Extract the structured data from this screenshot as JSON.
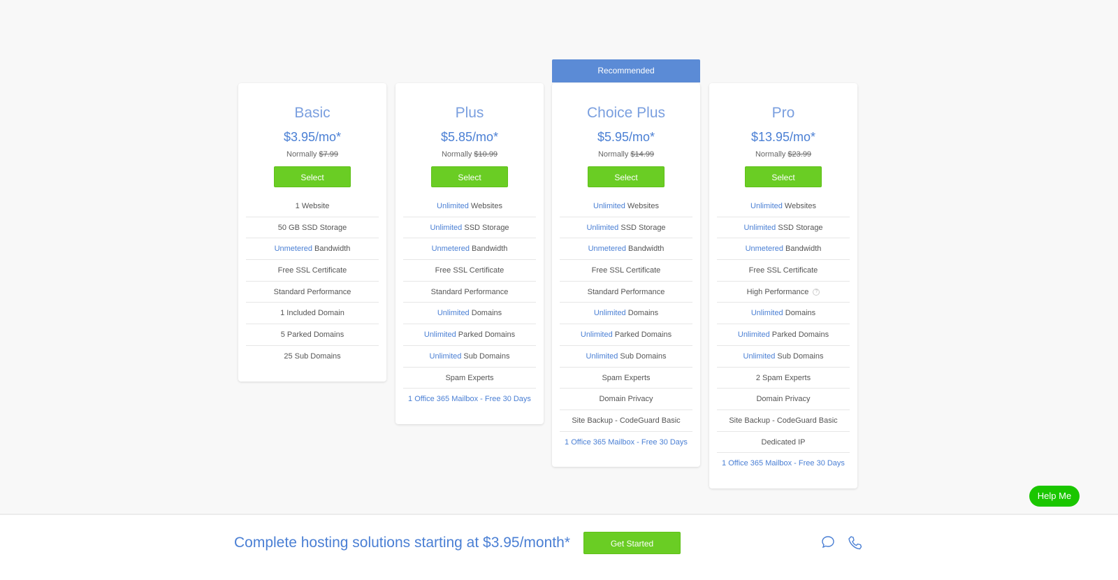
{
  "recommended_label": "Recommended",
  "plans": [
    {
      "name": "Basic",
      "price": "$3.95/mo*",
      "normally_label": "Normally",
      "normal_price": "$7.99",
      "select_label": "Select",
      "features": [
        {
          "hl": "",
          "text": "1 Website"
        },
        {
          "hl": "",
          "text": "50 GB SSD Storage"
        },
        {
          "hl": "Unmetered",
          "text": " Bandwidth"
        },
        {
          "hl": "",
          "text": "Free SSL Certificate"
        },
        {
          "hl": "",
          "text": "Standard Performance"
        },
        {
          "hl": "",
          "text": "1 Included Domain"
        },
        {
          "hl": "",
          "text": "5 Parked Domains"
        },
        {
          "hl": "",
          "text": "25 Sub Domains"
        }
      ]
    },
    {
      "name": "Plus",
      "price": "$5.85/mo*",
      "normally_label": "Normally",
      "normal_price": "$10.99",
      "select_label": "Select",
      "features": [
        {
          "hl": "Unlimited",
          "text": " Websites"
        },
        {
          "hl": "Unlimited",
          "text": " SSD Storage"
        },
        {
          "hl": "Unmetered",
          "text": " Bandwidth"
        },
        {
          "hl": "",
          "text": "Free SSL Certificate"
        },
        {
          "hl": "",
          "text": "Standard Performance"
        },
        {
          "hl": "Unlimited",
          "text": " Domains"
        },
        {
          "hl": "Unlimited",
          "text": " Parked Domains"
        },
        {
          "hl": "Unlimited",
          "text": " Sub Domains"
        },
        {
          "hl": "",
          "text": "Spam Experts"
        },
        {
          "hl": "1 Office 365 Mailbox - Free 30 Days",
          "text": ""
        }
      ]
    },
    {
      "name": "Choice Plus",
      "price": "$5.95/mo*",
      "normally_label": "Normally",
      "normal_price": "$14.99",
      "select_label": "Select",
      "features": [
        {
          "hl": "Unlimited",
          "text": " Websites"
        },
        {
          "hl": "Unlimited",
          "text": " SSD Storage"
        },
        {
          "hl": "Unmetered",
          "text": " Bandwidth"
        },
        {
          "hl": "",
          "text": "Free SSL Certificate"
        },
        {
          "hl": "",
          "text": "Standard Performance"
        },
        {
          "hl": "Unlimited",
          "text": " Domains"
        },
        {
          "hl": "Unlimited",
          "text": " Parked Domains"
        },
        {
          "hl": "Unlimited",
          "text": " Sub Domains"
        },
        {
          "hl": "",
          "text": "Spam Experts"
        },
        {
          "hl": "",
          "text": "Domain Privacy"
        },
        {
          "hl": "",
          "text": "Site Backup - CodeGuard Basic"
        },
        {
          "hl": "1 Office 365 Mailbox - Free 30 Days",
          "text": ""
        }
      ]
    },
    {
      "name": "Pro",
      "price": "$13.95/mo*",
      "normally_label": "Normally",
      "normal_price": "$23.99",
      "select_label": "Select",
      "features": [
        {
          "hl": "Unlimited",
          "text": " Websites"
        },
        {
          "hl": "Unlimited",
          "text": " SSD Storage"
        },
        {
          "hl": "Unmetered",
          "text": " Bandwidth"
        },
        {
          "hl": "",
          "text": "Free SSL Certificate"
        },
        {
          "hl": "",
          "text": "High Performance",
          "info": "?"
        },
        {
          "hl": "Unlimited",
          "text": " Domains"
        },
        {
          "hl": "Unlimited",
          "text": " Parked Domains"
        },
        {
          "hl": "Unlimited",
          "text": " Sub Domains"
        },
        {
          "hl": "",
          "text": "2 Spam Experts"
        },
        {
          "hl": "",
          "text": "Domain Privacy"
        },
        {
          "hl": "",
          "text": "Site Backup - CodeGuard Basic"
        },
        {
          "hl": "",
          "text": "Dedicated IP"
        },
        {
          "hl": "1 Office 365 Mailbox - Free 30 Days",
          "text": ""
        }
      ]
    }
  ],
  "footer": {
    "tagline": "Complete hosting solutions starting at $3.95/month*",
    "cta_label": "Get Started",
    "icons": [
      "chat-icon",
      "phone-icon"
    ]
  },
  "help_label": "Help Me",
  "colors": {
    "accent": "#4a7fd4",
    "button": "#6acd24",
    "banner": "#5b8bd6",
    "help": "#1ac600"
  }
}
